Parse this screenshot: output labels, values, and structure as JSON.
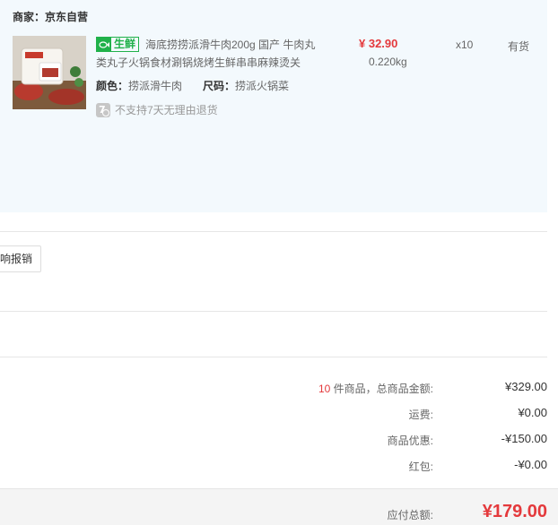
{
  "merchant": {
    "label": "商家：",
    "name": "京东自营"
  },
  "product": {
    "tag_text": "生鲜",
    "name": "海底捞捞派滑牛肉200g 国产 牛肉丸类丸子火锅食材涮锅烧烤生鲜串串麻辣烫关",
    "price": "¥ 32.90",
    "weight": "0.220kg",
    "quantity": "x10",
    "stock": "有货",
    "color_label": "颜色：",
    "color_value": "捞派滑牛肉",
    "size_label": "尺码：",
    "size_value": "捞派火锅菜",
    "return_icon_digit": "7",
    "return_policy": "不支持7天无理由退货"
  },
  "actions": {
    "reimburse_button": "响报销"
  },
  "summary": {
    "item_count": "10",
    "items_label": "件商品，总商品金额:",
    "items_total": "¥329.00",
    "shipping_label": "运费:",
    "shipping": "¥0.00",
    "discount_label": "商品优惠:",
    "discount": "-¥150.00",
    "redpacket_label": "红包:",
    "redpacket": "-¥0.00",
    "payable_label": "应付总额:",
    "payable": "¥179.00"
  },
  "colors": {
    "accent_red": "#e4393c",
    "fresh_green": "#20b14a",
    "panel_bg": "#f3f9fd"
  }
}
